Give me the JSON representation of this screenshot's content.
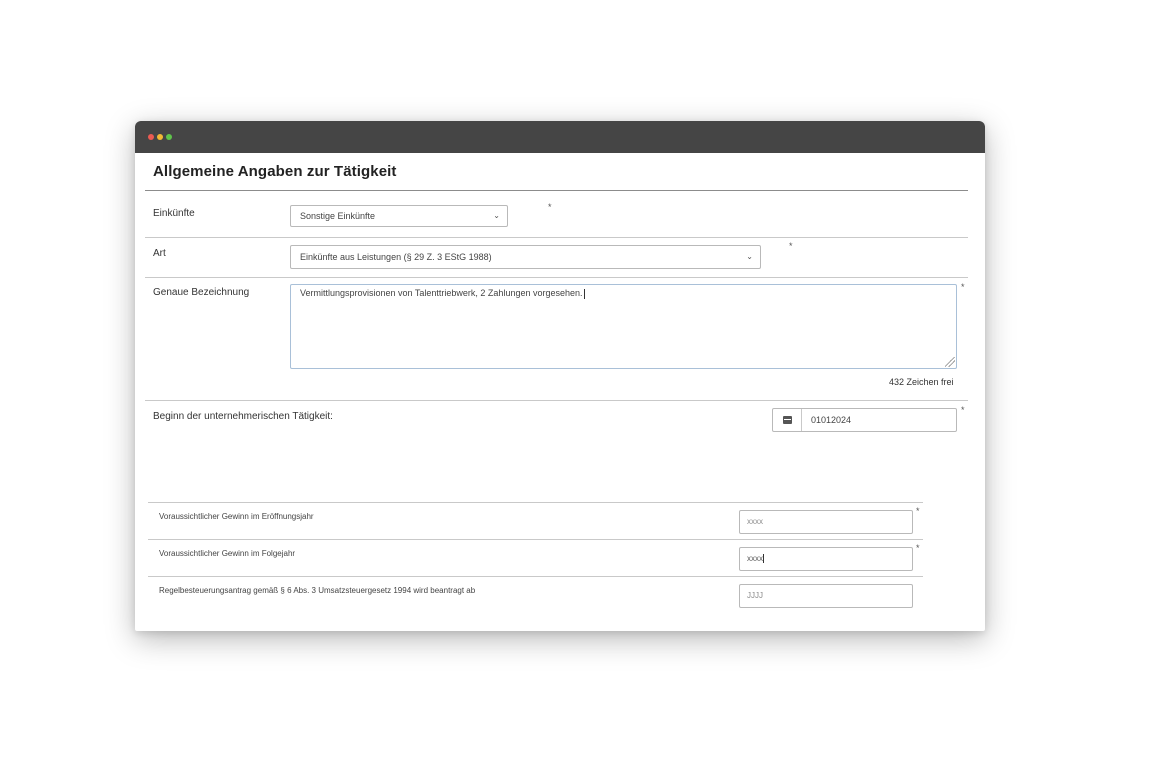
{
  "window": {
    "controls": [
      "close",
      "minimize",
      "maximize"
    ]
  },
  "form": {
    "section_title": "Allgemeine Angaben zur Tätigkeit",
    "required_marker": "*",
    "einkuenfte": {
      "label": "Einkünfte",
      "value": "Sonstige Einkünfte",
      "chevron": "⌄"
    },
    "art": {
      "label": "Art",
      "value": "Einkünfte aus Leistungen (§ 29 Z. 3 EStG 1988)",
      "chevron": "⌄"
    },
    "bezeichnung": {
      "label": "Genaue Bezeichnung",
      "value": "Vermittlungsprovisionen von Talenttriebwerk, 2 Zahlungen vorgesehen.",
      "counter": "432 Zeichen frei"
    },
    "beginn": {
      "label": "Beginn der unternehmerischen Tätigkeit:",
      "value": "01012024",
      "icon": "calendar-icon"
    },
    "gewinn_eroeffnung": {
      "label": "Voraussichtlicher Gewinn im Eröffnungsjahr",
      "placeholder": "xxxx"
    },
    "gewinn_folge": {
      "label": "Voraussichtlicher Gewinn im Folgejahr",
      "value": "xxxx"
    },
    "regelbesteuerung": {
      "label": "Regelbesteuerungsantrag gemäß § 6 Abs. 3 Umsatzsteuergesetz 1994 wird beantragt ab",
      "placeholder": "JJJJ"
    }
  }
}
